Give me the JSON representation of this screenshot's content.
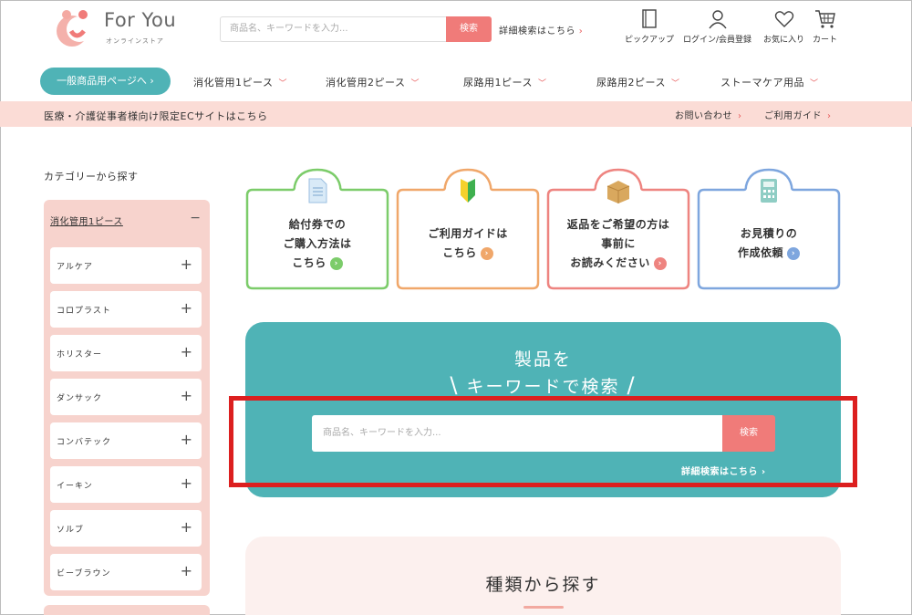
{
  "header": {
    "logo_text": "For You",
    "logo_sub": "オンラインストア",
    "search_placeholder": "商品名、キーワードを入力...",
    "search_button": "検索",
    "advanced_link": "詳細検索はこちら",
    "icons": [
      {
        "label": "ピックアップ",
        "icon": "book-icon"
      },
      {
        "label": "ログイン/会員登録",
        "icon": "user-icon"
      },
      {
        "label": "お気に入り",
        "icon": "heart-icon"
      },
      {
        "label": "カート",
        "icon": "cart-icon"
      }
    ]
  },
  "nav": {
    "general_button": "一般商品用ページへ",
    "items": [
      "消化管用1ピース",
      "消化管用2ピース",
      "尿路用1ピース",
      "尿路用2ピース",
      "ストーマケア用品"
    ]
  },
  "band": {
    "left_link": "医療・介護従事者様向け限定ECサイトはこちら",
    "contact": "お問い合わせ",
    "guide": "ご利用ガイド"
  },
  "sidebar": {
    "title": "カテゴリーから探す",
    "section": "消化管用1ピース",
    "items": [
      "アルケア",
      "コロプラスト",
      "ホリスター",
      "ダンサック",
      "コンバテック",
      "イーキン",
      "ソルブ",
      "ビーブラウン"
    ]
  },
  "cards": [
    {
      "lines": [
        "給付券での",
        "ご購入方法は",
        "こちら"
      ],
      "color": "#7ccc6a",
      "icon": "document-icon"
    },
    {
      "lines": [
        "ご利用ガイドは",
        "こちら"
      ],
      "color": "#f0a76a",
      "icon": "beginner-mark-icon"
    },
    {
      "lines": [
        "返品をご希望の方は",
        "事前に",
        "お読みください"
      ],
      "color": "#ee8480",
      "icon": "box-icon"
    },
    {
      "lines": [
        "お見積りの",
        "作成依頼"
      ],
      "color": "#7ea6de",
      "icon": "calculator-icon"
    }
  ],
  "search": {
    "title_line1": "製品を",
    "title_line2": "キーワードで検索",
    "placeholder": "商品名、キーワードを入力...",
    "button": "検索",
    "advanced": "詳細検索はこちら"
  },
  "types": {
    "title": "種類から探す"
  },
  "colors": {
    "teal": "#4fb3b6",
    "coral": "#f07b79",
    "pink_band": "#fbdcd6",
    "highlight": "#dc1f1f"
  }
}
